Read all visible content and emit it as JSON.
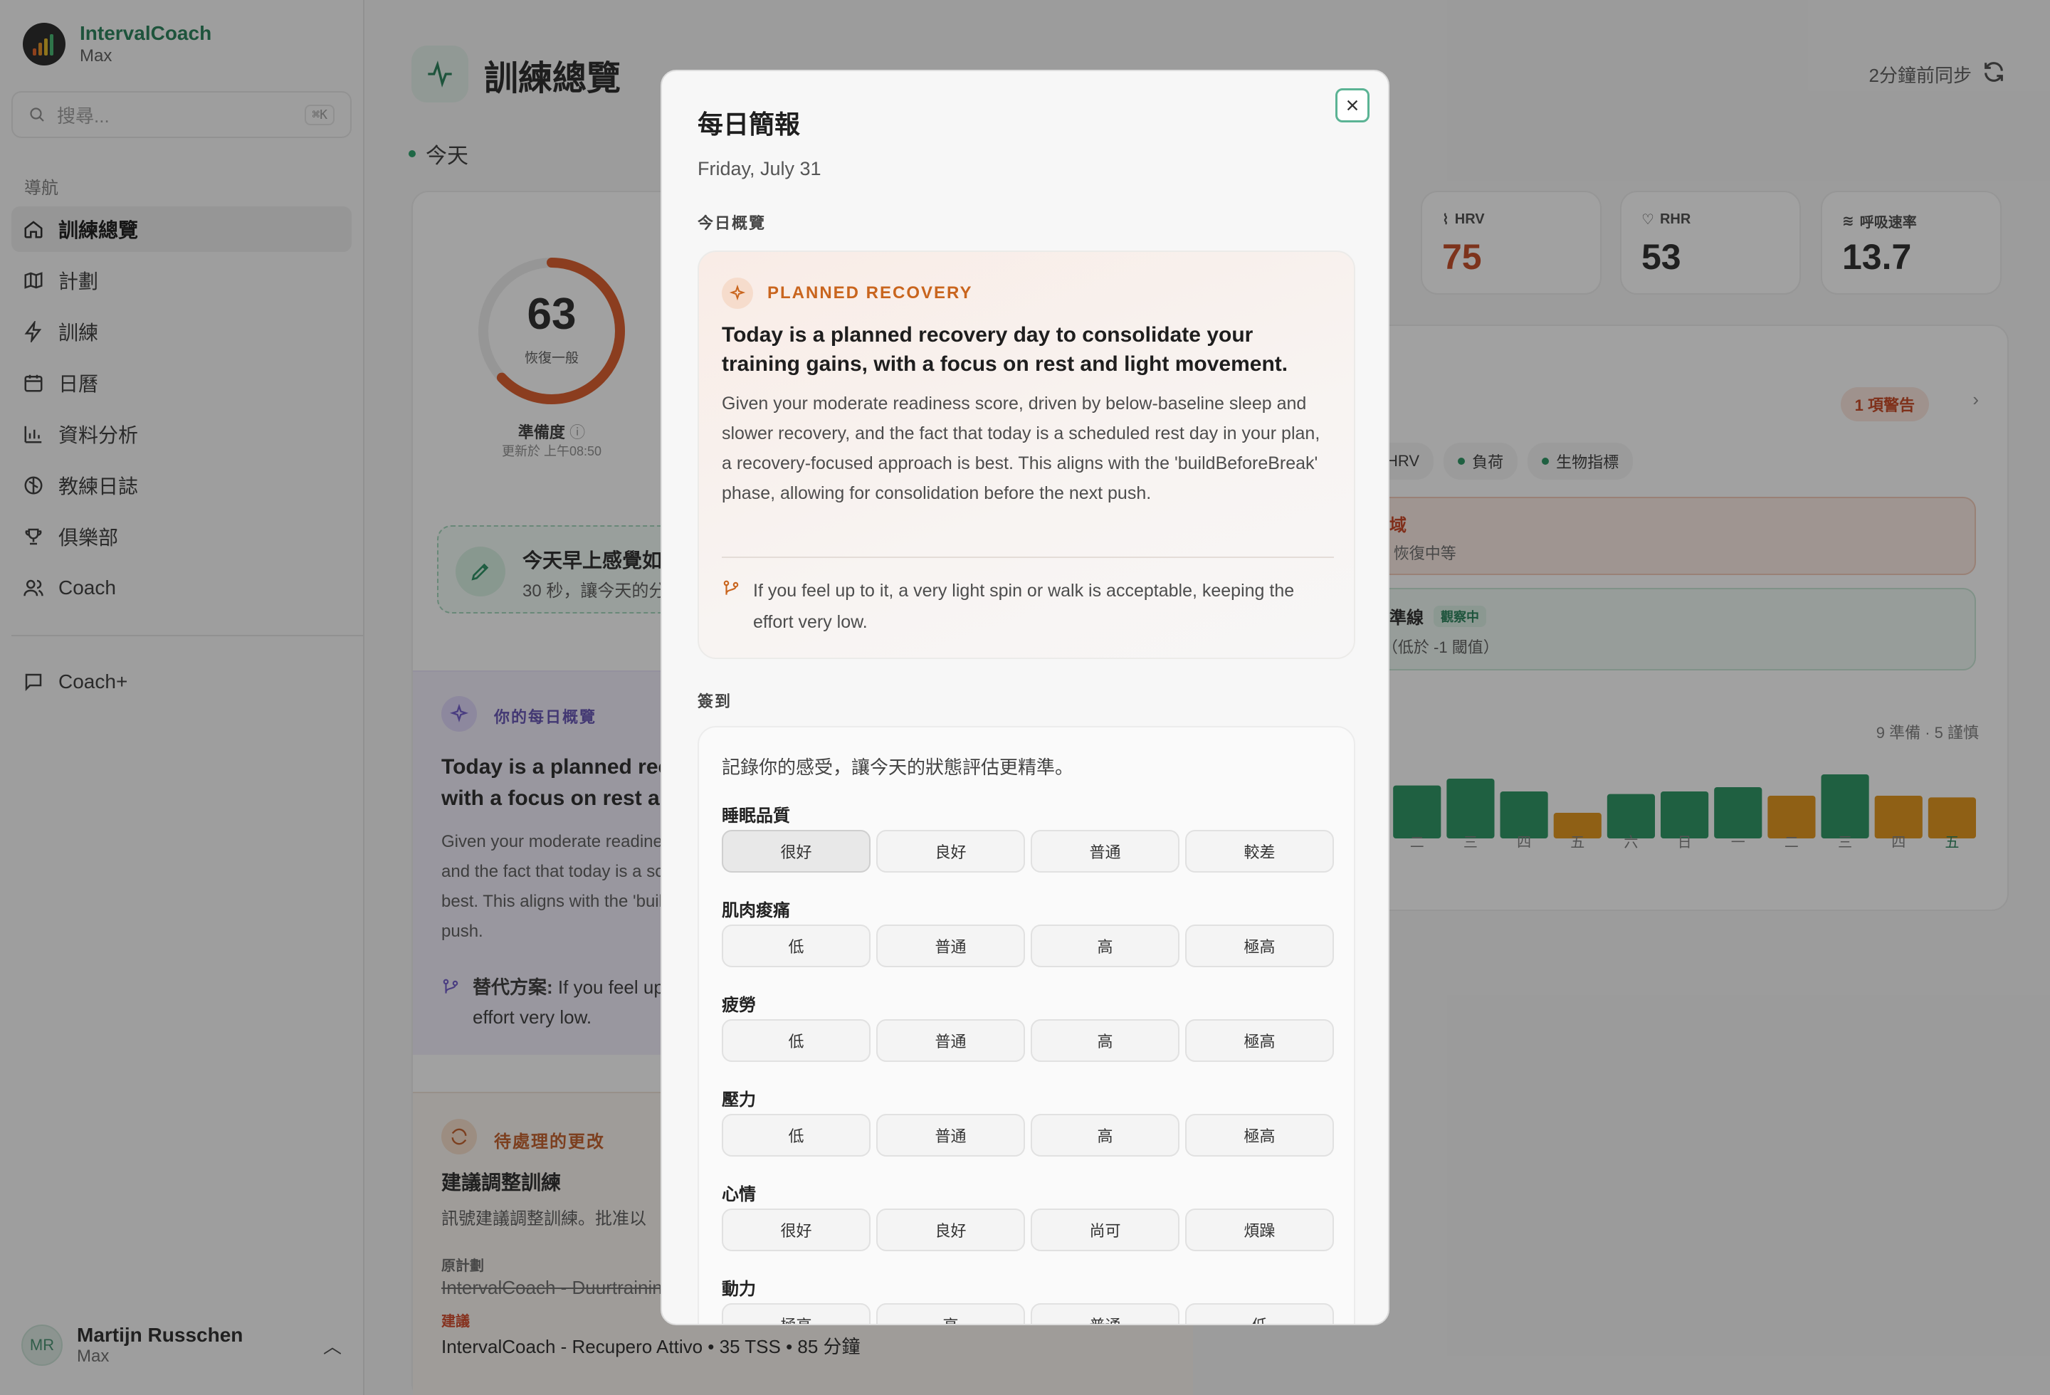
{
  "app": {
    "name": "IntervalCoach",
    "user_short": "Max"
  },
  "search": {
    "placeholder": "搜尋...",
    "shortcut": "⌘K"
  },
  "nav": {
    "label": "導航",
    "items": [
      {
        "label": "訓練總覽",
        "icon": "home-icon",
        "active": true
      },
      {
        "label": "計劃",
        "icon": "map-icon"
      },
      {
        "label": "訓練",
        "icon": "bolt-icon"
      },
      {
        "label": "日曆",
        "icon": "calendar-icon"
      },
      {
        "label": "資料分析",
        "icon": "bar-chart-icon"
      },
      {
        "label": "教練日誌",
        "icon": "brain-icon"
      },
      {
        "label": "俱樂部",
        "icon": "trophy-icon"
      },
      {
        "label": "Coach",
        "icon": "users-icon"
      }
    ],
    "secondary": [
      {
        "label": "Coach+",
        "icon": "message-icon"
      }
    ]
  },
  "user": {
    "initials": "MR",
    "name": "Martijn Russchen",
    "sub": "Max"
  },
  "header": {
    "title": "訓練總覽",
    "today": "今天",
    "sync": "2分鐘前同步"
  },
  "readiness": {
    "score": "63",
    "state": "恢復一般",
    "label": "準備度",
    "updated": "更新於 上午08:50",
    "fraction": 0.63
  },
  "checkin_prompt": {
    "title": "今天早上感覺如何",
    "sub": "30 秒，讓今天的分"
  },
  "daily_summary": {
    "label": "你的每日概覽",
    "title": "Today is a planned recovery day to consolidate your training gains, with a focus on rest and light movement.",
    "body": "Given your moderate readiness score, driven by below-baseline sleep and slower recovery, and the fact that today is a scheduled rest day in your plan, a recovery-focused approach is best. This aligns with the 'buildBeforeBreak' phase, allowing for consolidation before the next push.",
    "alt_label": "替代方案:",
    "alt": "If you feel up to it, a very light spin or walk is acceptable, keeping the effort very low."
  },
  "pending": {
    "label": "待處理的更改",
    "title": "建議調整訓練",
    "desc": "訊號建議調整訓練。批准以",
    "orig_label": "原計劃",
    "orig": "IntervalCoach - Duurtraining",
    "sug_label": "建議",
    "sug": "IntervalCoach - Recupero Attivo  •  35 TSS  •  85 分鐘"
  },
  "metrics": [
    {
      "label": "HRV",
      "value": "75",
      "icon": "pulse-icon",
      "color": "#c2421a"
    },
    {
      "label": "RHR",
      "value": "53",
      "icon": "heart-icon",
      "color": "#222222"
    },
    {
      "label": "呼吸速率",
      "value": "13.7",
      "icon": "wind-icon",
      "color": "#222222"
    }
  ],
  "signals": {
    "warning": "1 項警告",
    "chips": [
      "HRV",
      "負荷",
      "生物指標"
    ],
    "zone_title": "色區域",
    "zone_sub": "% — 恢復中等",
    "baseline_title": "於基準線",
    "baseline_badge": "觀察中",
    "baseline_sub": "-1.3（低於 -1 閾值）",
    "bars_label": "9 準備 · 5 謹慎",
    "days": [
      "二",
      "三",
      "四",
      "五",
      "六",
      "日",
      "一",
      "二",
      "三",
      "四",
      "五"
    ],
    "bars": [
      {
        "level": 0.55,
        "status": "good"
      },
      {
        "level": 0.62,
        "status": "good"
      },
      {
        "level": 0.7,
        "status": "good"
      },
      {
        "level": 0.55,
        "status": "good"
      },
      {
        "level": 0.3,
        "status": "caution"
      },
      {
        "level": 0.52,
        "status": "good"
      },
      {
        "level": 0.55,
        "status": "good"
      },
      {
        "level": 0.6,
        "status": "good"
      },
      {
        "level": 0.5,
        "status": "caution"
      },
      {
        "level": 0.75,
        "status": "good"
      },
      {
        "level": 0.5,
        "status": "caution"
      },
      {
        "level": 0.48,
        "status": "caution"
      }
    ],
    "colors": {
      "good": "#1f8f5a",
      "caution": "#e0900f"
    }
  },
  "modal": {
    "title": "每日簡報",
    "date": "Friday, July 31",
    "overview_label": "今日概覽",
    "rec_label": "PLANNED RECOVERY",
    "rec_title": "Today is a planned recovery day to consolidate your training gains, with a focus on rest and light movement.",
    "rec_body": "Given your moderate readiness score, driven by below-baseline sleep and slower recovery, and the fact that today is a scheduled rest day in your plan, a recovery-focused approach is best. This aligns with the 'buildBeforeBreak' phase, allowing for consolidation before the next push.",
    "rec_alt": "If you feel up to it, a very light spin or walk is acceptable, keeping the effort very low.",
    "checkin_label": "簽到",
    "checkin_hint": "記錄你的感受，讓今天的狀態評估更精準。",
    "groups": [
      {
        "label": "睡眠品質",
        "options": [
          "很好",
          "良好",
          "普通",
          "較差"
        ],
        "selected": 0
      },
      {
        "label": "肌肉痠痛",
        "options": [
          "低",
          "普通",
          "高",
          "極高"
        ]
      },
      {
        "label": "疲勞",
        "options": [
          "低",
          "普通",
          "高",
          "極高"
        ]
      },
      {
        "label": "壓力",
        "options": [
          "低",
          "普通",
          "高",
          "極高"
        ]
      },
      {
        "label": "心情",
        "options": [
          "很好",
          "良好",
          "尚可",
          "煩躁"
        ]
      },
      {
        "label": "動力",
        "options": [
          "極高",
          "高",
          "普通",
          "低"
        ]
      }
    ]
  }
}
